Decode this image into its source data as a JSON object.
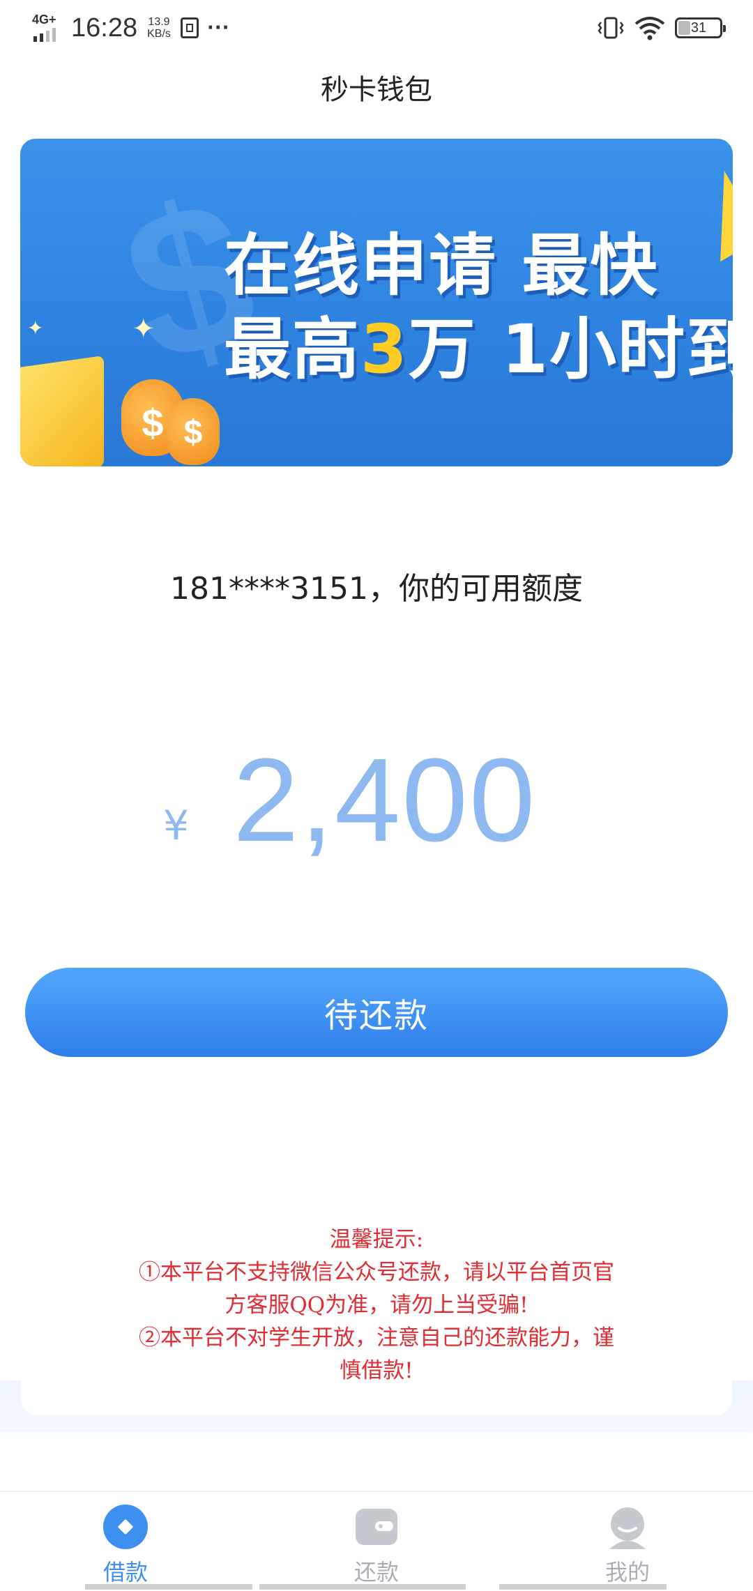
{
  "status_bar": {
    "network": "4G+",
    "time": "16:28",
    "speed_value": "13.9",
    "speed_unit": "KB/s",
    "more": "···",
    "battery": "31"
  },
  "header": {
    "title": "秒卡钱包"
  },
  "banner": {
    "line1": "在线申请 最快",
    "line2_a": "最高",
    "line2_num": "3",
    "line2_b": "万 1小时到"
  },
  "quota": {
    "label": "181****3151，你的可用额度",
    "currency": "¥",
    "amount": "2,400"
  },
  "repay_button": {
    "label": "待还款"
  },
  "notice": {
    "title": "温馨提示:",
    "line1": "①本平台不支持微信公众号还款，请以平台首页官",
    "line2": "方客服QQ为准，请勿上当受骗!",
    "line3": "②本平台不对学生开放，注意自己的还款能力，谨",
    "line4": "慎借款!"
  },
  "tabs": [
    {
      "label": "借款",
      "icon": "loan-icon",
      "active": true
    },
    {
      "label": "还款",
      "icon": "wallet-icon",
      "active": false
    },
    {
      "label": "我的",
      "icon": "profile-icon",
      "active": false
    }
  ],
  "colors": {
    "accent": "#3d8ff0",
    "amount": "#8db9f0",
    "notice": "#e02c32",
    "banner": "#2f83e0",
    "inactive_tab": "#a9aeb6"
  }
}
